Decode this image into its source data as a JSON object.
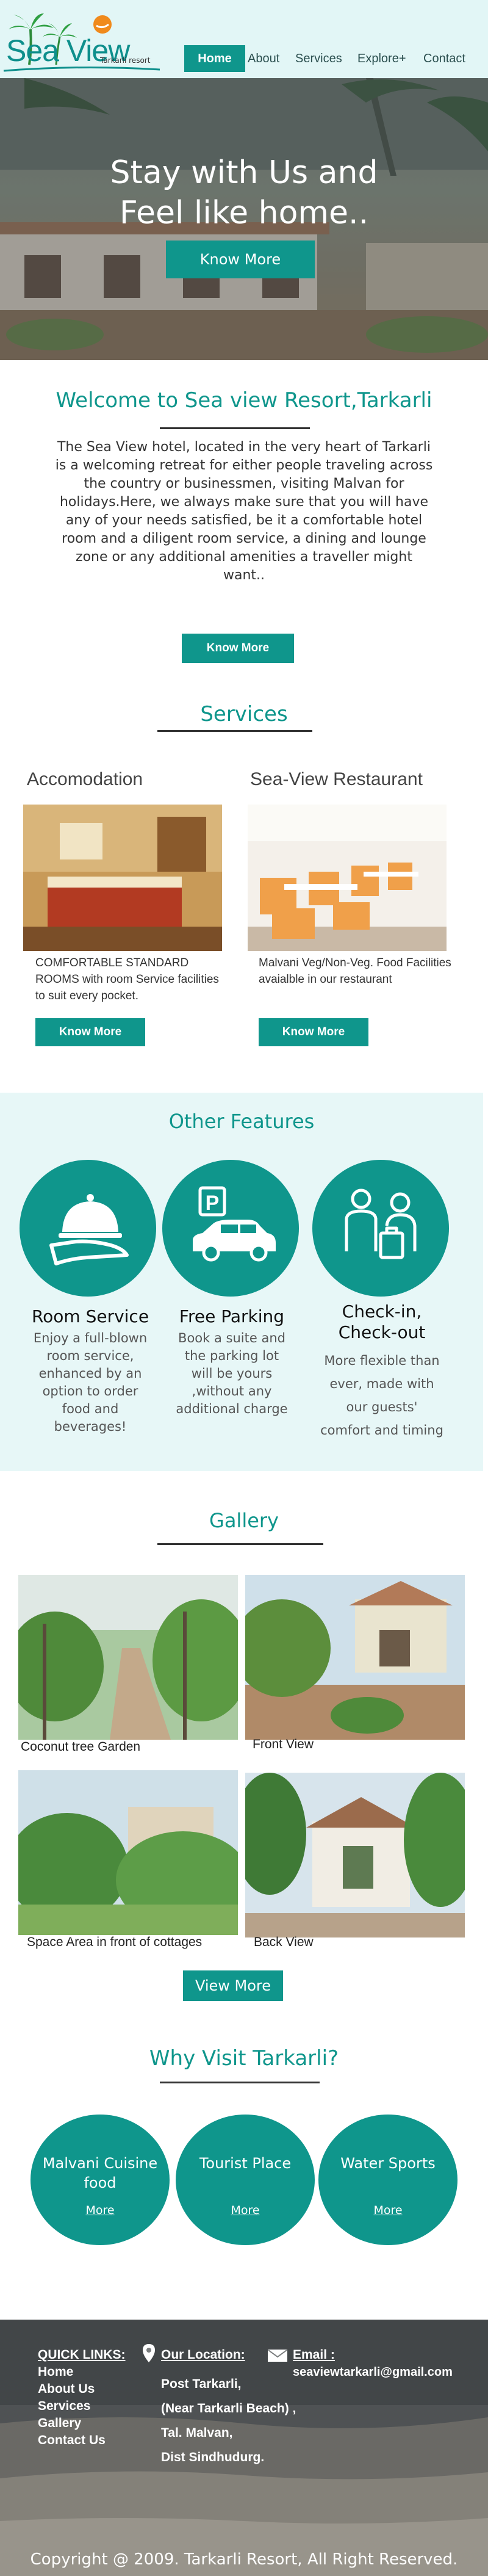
{
  "nav": {
    "logo_main": "Sea View",
    "logo_sub": "Tarkarli resort",
    "links": [
      "Home",
      "About",
      "Services",
      "Explore+",
      "Contact"
    ]
  },
  "hero": {
    "title_line1": "Stay with Us and",
    "title_line2": "Feel like home..",
    "button": "Know More"
  },
  "welcome": {
    "title": "Welcome to Sea view Resort,Tarkarli",
    "text": "The Sea View hotel, located in the very heart of Tarkarli is a welcoming retreat for either people traveling across the country or businessmen, visiting  Malvan for holidays.Here, we always make sure that you will have any of your needs satisfied, be it a comfortable hotel room and a diligent room service, a dining and lounge zone or any additional amenities a traveller might want..",
    "button": "Know More"
  },
  "services": {
    "title": "Services",
    "items": [
      {
        "heading": "Accomodation",
        "desc": "COMFORTABLE STANDARD ROOMS with room Service facilities to suit every pocket.",
        "button": "Know More"
      },
      {
        "heading": "Sea-View Restaurant",
        "desc": "Malvani Veg/Non-Veg. Food Facilities avaialble in our restaurant",
        "button": "Know More"
      }
    ]
  },
  "features": {
    "title": "Other Features",
    "items": [
      {
        "name": "Room Service",
        "icon": "cloche-icon",
        "desc": [
          "Enjoy a full-blown",
          "room service,",
          "enhanced by an",
          "option to order",
          "food and",
          "beverages!"
        ]
      },
      {
        "name": "Free  Parking",
        "icon": "parking-car-icon",
        "desc": [
          "Book a suite and",
          "the parking lot",
          "will be yours",
          ",without any",
          "additional charge"
        ]
      },
      {
        "name_lines": [
          "Check-in,",
          "Check-out"
        ],
        "icon": "check-in-icon",
        "desc": [
          "More flexible than",
          "ever, made with",
          "our guests'",
          "comfort and timing"
        ]
      }
    ]
  },
  "gallery": {
    "title": "Gallery",
    "captions": [
      "Coconut tree Garden",
      "Front View",
      "Space Area in front of cottages",
      "Back View"
    ],
    "button": "View More"
  },
  "why": {
    "title": "Why Visit Tarkarli?",
    "items": [
      {
        "label_lines": [
          "Malvani Cuisine",
          "food"
        ],
        "more": "More"
      },
      {
        "label_lines": [
          "Tourist Place"
        ],
        "more": "More"
      },
      {
        "label_lines": [
          "Water Sports"
        ],
        "more": "More"
      }
    ]
  },
  "footer": {
    "quick_links_title": "QUICK LINKS:",
    "quick_links": [
      "Home",
      "About Us",
      "Services",
      "Gallery",
      "Contact Us"
    ],
    "location_title": "Our Location:",
    "location_lines": [
      "Post Tarkarli,",
      "(Near Tarkarli Beach) ,",
      "Tal. Malvan,",
      "Dist Sindhudurg."
    ],
    "email_title": "Email :",
    "email": "seaviewtarkarli@gmail.com",
    "copyright": "Copyright @ 2009. Tarkarli Resort, All Right Reserved."
  },
  "colors": {
    "teal": "#0f968c",
    "pale_teal": "#e7f7f7",
    "heading_teal": "#0f968c"
  }
}
